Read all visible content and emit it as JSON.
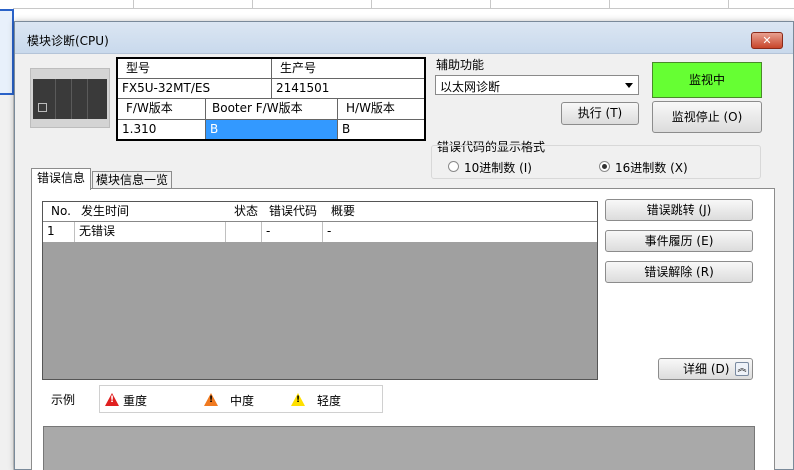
{
  "dialog": {
    "title": "模块诊断(CPU)",
    "close_label": "✕"
  },
  "info": {
    "model_label": "型号",
    "serial_label": "生产号",
    "model_value": "FX5U-32MT/ES",
    "serial_value": "2141501",
    "fw_label": "F/W版本",
    "booter_label": "Booter F/W版本",
    "hw_label": "H/W版本",
    "fw_value": "1.310",
    "booter_value": "B",
    "hw_value": "B"
  },
  "aux": {
    "label": "辅助功能",
    "selected": "以太网诊断",
    "execute_label": "执行 (T)"
  },
  "monitor": {
    "status_label": "监视中",
    "stop_label": "监视停止 (O)",
    "status_color": "#66ff33"
  },
  "error_format": {
    "label": "错误代码的显示格式",
    "option_decimal": "10进制数 (I)",
    "option_hex": "16进制数 (X)",
    "selected": "hex"
  },
  "tabs": [
    {
      "label": "错误信息",
      "active": true
    },
    {
      "label": "模块信息一览",
      "active": false
    }
  ],
  "error_list": {
    "columns": [
      "No.",
      "发生时间",
      "状态",
      "错误代码",
      "概要"
    ],
    "rows": [
      {
        "no": "1",
        "time": "无错误",
        "status": "",
        "code": "-",
        "summary": "-"
      }
    ]
  },
  "side_buttons": {
    "jump": "错误跳转 (J)",
    "history": "事件履历 (E)",
    "clear": "错误解除 (R)",
    "detail": "详细 (D)"
  },
  "legend": {
    "label": "示例",
    "major": "重度",
    "moderate": "中度",
    "minor": "轻度",
    "colors": {
      "major": "#e02020",
      "moderate": "#f07a20",
      "minor": "#ffe000"
    }
  }
}
